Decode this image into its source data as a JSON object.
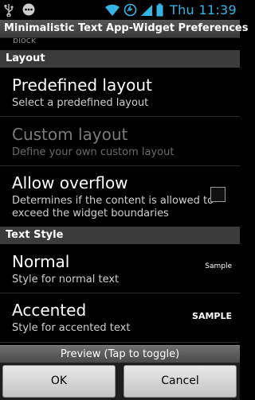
{
  "status_bar": {
    "time": "Thu  11:39",
    "icons": [
      "usb-icon",
      "notification-dots-icon",
      "wifi-icon",
      "sync-icon",
      "signal-icon",
      "battery-icon"
    ],
    "accent_color": "#33b5e5"
  },
  "window": {
    "title": "Minimalistic Text App-Widget Preferences"
  },
  "list": {
    "cut_off_text": "block",
    "sections": [
      {
        "header": "Layout"
      },
      {
        "header": "Text Style"
      }
    ],
    "layout_items": [
      {
        "title": "Predefined layout",
        "summary": "Select a predefined layout",
        "enabled": true
      },
      {
        "title": "Custom layout",
        "summary": "Define your own custom layout",
        "enabled": false
      },
      {
        "title": "Allow overflow",
        "summary_line1": "Determines if the content is allowed to",
        "summary_line2": "exceed the widget boundaries",
        "checked": false
      }
    ],
    "style_items": [
      {
        "title": "Normal",
        "summary": "Style for normal text",
        "sample": "Sample"
      },
      {
        "title": "Accented",
        "summary": "Style for accented text",
        "sample": "SAMPLE"
      }
    ]
  },
  "preview": {
    "label": "Preview (Tap to toggle)"
  },
  "buttons": {
    "ok": "OK",
    "cancel": "Cancel"
  }
}
